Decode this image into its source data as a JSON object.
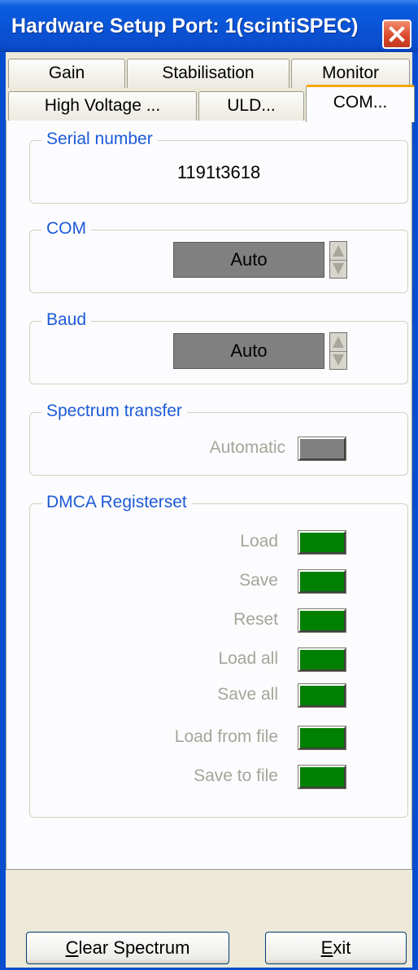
{
  "window": {
    "title": "Hardware Setup Port: 1(scintiSPEC)",
    "close_icon": "close-icon"
  },
  "tabs": {
    "row1": [
      {
        "label": "Gain"
      },
      {
        "label": "Stabilisation"
      },
      {
        "label": "Monitor"
      }
    ],
    "row2": [
      {
        "label": "High Voltage ..."
      },
      {
        "label": "ULD..."
      },
      {
        "label": "COM...",
        "active": true
      }
    ]
  },
  "serial": {
    "title": "Serial number",
    "value": "1191t3618"
  },
  "com": {
    "title": "COM",
    "value": "Auto"
  },
  "baud": {
    "title": "Baud",
    "value": "Auto"
  },
  "spectrum": {
    "title": "Spectrum transfer",
    "automatic_label": "Automatic",
    "indicator_color": "#808080"
  },
  "dmca": {
    "title": "DMCA Registerset",
    "indicator_color": "#008000",
    "items": [
      {
        "label": "Load"
      },
      {
        "label": "Save"
      },
      {
        "label": "Reset"
      },
      {
        "label": "Load all"
      },
      {
        "label": "Save all"
      },
      {
        "label": "Load from file"
      },
      {
        "label": "Save to file"
      }
    ]
  },
  "buttons": {
    "clear_first": "C",
    "clear_rest": "lear Spectrum",
    "exit_first": "E",
    "exit_rest": "xit"
  }
}
